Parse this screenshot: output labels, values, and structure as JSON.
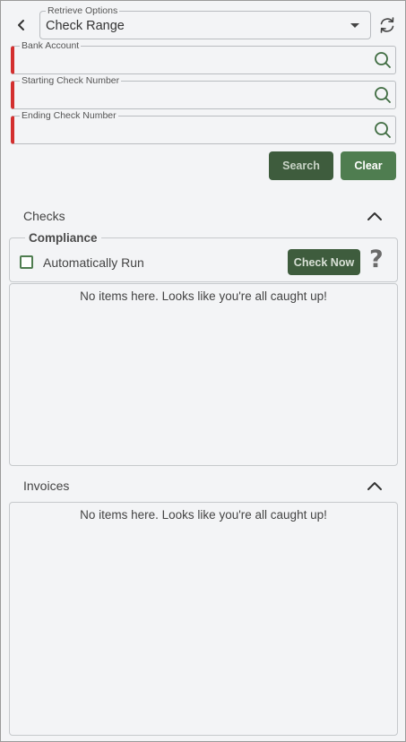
{
  "retrieve": {
    "label": "Retrieve Options",
    "value": "Check Range"
  },
  "fields": {
    "bank_account": "Bank Account",
    "starting_check": "Starting Check Number",
    "ending_check": "Ending Check Number"
  },
  "buttons": {
    "search": "Search",
    "clear": "Clear"
  },
  "checks": {
    "title": "Checks",
    "compliance": {
      "legend": "Compliance",
      "auto_run_label": "Automatically Run",
      "auto_run_checked": false,
      "check_now": "Check Now",
      "help": "?"
    },
    "empty_text": "No items here. Looks like you're all caught up!"
  },
  "invoices": {
    "title": "Invoices",
    "empty_text": "No items here. Looks like you're all caught up!"
  },
  "colors": {
    "required_marker": "#d32f2f",
    "primary_dark": "#3e5c3d",
    "primary": "#4f7d50",
    "background": "#f3f4f6"
  },
  "icons": [
    "chevron-left-icon",
    "chevron-down-icon",
    "refresh-icon",
    "search-icon",
    "chevron-up-icon",
    "help-icon"
  ]
}
